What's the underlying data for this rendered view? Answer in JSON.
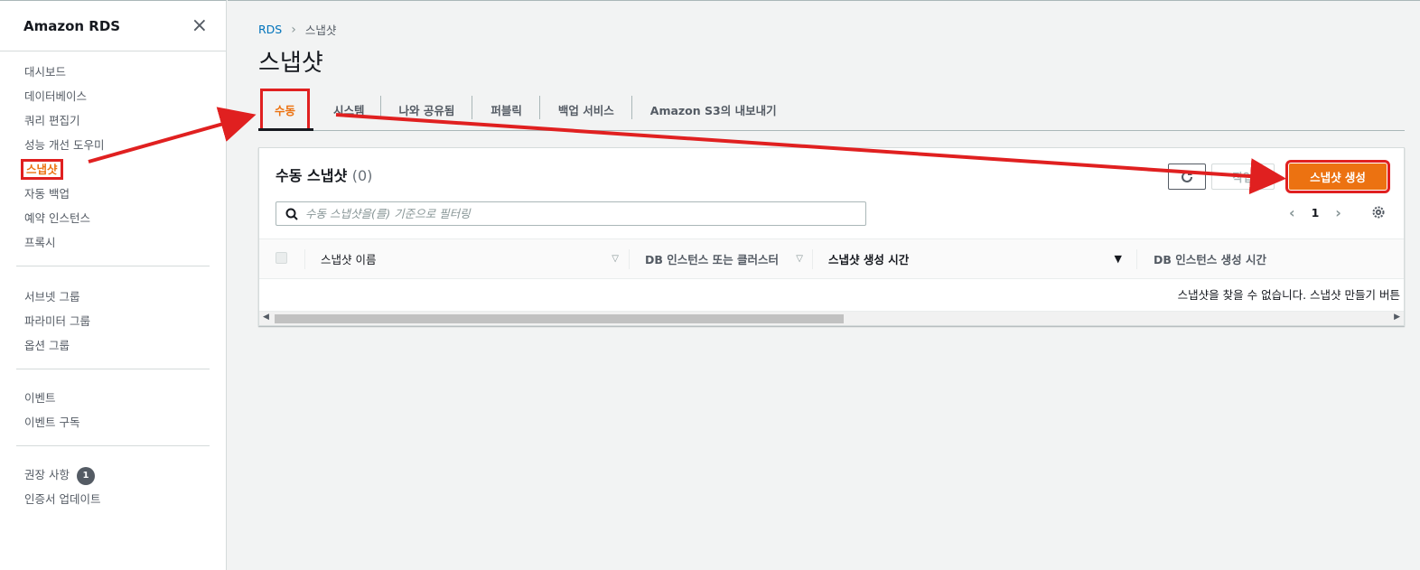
{
  "sidebar": {
    "title": "Amazon RDS",
    "close_icon": "×",
    "group1": [
      "대시보드",
      "데이터베이스",
      "쿼리 편집기",
      "성능 개선 도우미",
      "스냅샷",
      "자동 백업",
      "예약 인스턴스",
      "프록시"
    ],
    "group2": [
      "서브넷 그룹",
      "파라미터 그룹",
      "옵션 그룹"
    ],
    "group3": [
      "이벤트",
      "이벤트 구독"
    ],
    "group4_item1": "권장 사항",
    "group4_badge": "1",
    "group4_item2": "인증서 업데이트"
  },
  "breadcrumb": {
    "root": "RDS",
    "separator": "›",
    "current": "스냅샷"
  },
  "page_title": "스냅샷",
  "tabs": [
    "수동",
    "시스템",
    "나와 공유됨",
    "퍼블릭",
    "백업 서비스",
    "Amazon S3의 내보내기"
  ],
  "panel": {
    "title": "수동 스냅샷",
    "count": "(0)",
    "delete_label": "작업",
    "create_label": "스냅샷 생성",
    "search_placeholder": "수동 스냅샷을(를) 기준으로 필터링",
    "page_number": "1",
    "prev": "‹",
    "next": "›",
    "columns": [
      "스냅샷 이름",
      "DB 인스턴스 또는 클러스터",
      "스냅샷 생성 시간",
      "DB 인스턴스 생성 시간"
    ],
    "empty_message": "스냅샷을 찾을 수 없습니다. 스냅샷 만들기 버튼"
  },
  "accent_color": "#ec7211",
  "annotation_color": "#e02020"
}
